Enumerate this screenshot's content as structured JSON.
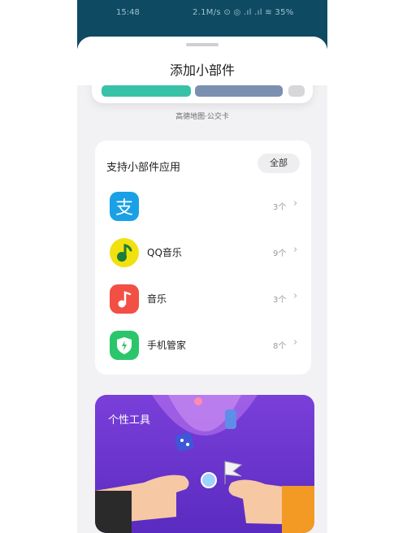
{
  "status_bar": {
    "time": "15:48",
    "right": "2.1M/s ⊙ ◎ .ıl .ıl ≋ 35%"
  },
  "sheet": {
    "title": "添加小部件"
  },
  "preview": {
    "caption": "高德地图·公交卡"
  },
  "supported_apps": {
    "title": "支持小部件应用",
    "all_button": "全部",
    "items": [
      {
        "label": "",
        "count": "3个",
        "icon": "alipay-icon",
        "color": "#1aa0e6"
      },
      {
        "label": "QQ音乐",
        "count": "9个",
        "icon": "qq-music-icon",
        "color": "#f1e10f"
      },
      {
        "label": "音乐",
        "count": "3个",
        "icon": "music-icon",
        "color": "#f24f45"
      },
      {
        "label": "手机管家",
        "count": "8个",
        "icon": "phone-manager-icon",
        "color": "#2bc66b"
      }
    ]
  },
  "tools_banner": {
    "title": "个性工具"
  },
  "colors": {
    "status_bg": "#0f4a63",
    "sheet_bg": "#f2f2f4",
    "banner_purple": "#6a36d0"
  }
}
